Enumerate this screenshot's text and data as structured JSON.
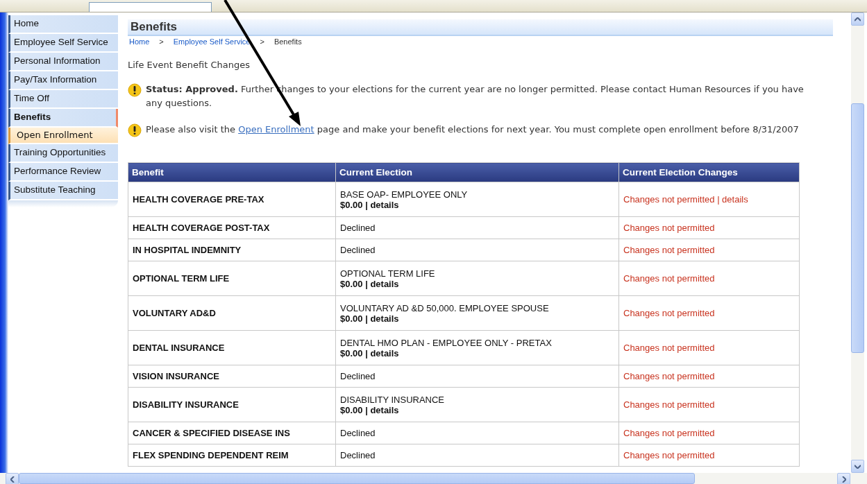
{
  "sidebar": {
    "items": [
      {
        "label": "Home",
        "selected": false
      },
      {
        "label": "Employee Self Service",
        "selected": false
      },
      {
        "label": "Personal Information",
        "selected": false
      },
      {
        "label": "Pay/Tax Information",
        "selected": false
      },
      {
        "label": "Time Off",
        "selected": false
      },
      {
        "label": "Benefits",
        "selected": true,
        "children": [
          {
            "label": "Open Enrollment",
            "highlighted": true
          }
        ]
      },
      {
        "label": "Training Opportunities",
        "selected": false
      },
      {
        "label": "Performance Review",
        "selected": false
      },
      {
        "label": "Substitute Teaching",
        "selected": false
      }
    ]
  },
  "page": {
    "title": "Benefits",
    "breadcrumb": [
      {
        "label": "Home",
        "kind": "link"
      },
      {
        "label": ">",
        "kind": "sep"
      },
      {
        "label": "Employee Self Service",
        "kind": "link"
      },
      {
        "label": ">",
        "kind": "sep"
      },
      {
        "label": "Benefits",
        "kind": "current"
      }
    ],
    "subtitle": "Life Event Benefit Changes",
    "alerts": [
      {
        "text": "**Status: Approved.** Further changes to your elections for the current year are no longer permitted.  Please contact Human Resources if you have any questions."
      },
      {
        "before": "Please also visit the ",
        "link": "Open Enrollment",
        "after": " page and make your benefit elections for next year. You must complete open enrollment before 8/31/2007"
      }
    ]
  },
  "table": {
    "columns": [
      "Benefit",
      "Current Election",
      "Current Election Changes"
    ],
    "rows": [
      {
        "benefit": "HEALTH COVERAGE PRE-TAX",
        "kind": "plan",
        "plan": "BASE OAP- EMPLOYEE ONLY",
        "cost": "$0.00 | details",
        "changes": "Changes not permitted | details"
      },
      {
        "benefit": "HEALTH COVERAGE POST-TAX",
        "kind": "declined",
        "plan": "Declined",
        "changes": "Changes not permitted"
      },
      {
        "benefit": "IN HOSPITAL INDEMNITY",
        "kind": "declined",
        "plan": "Declined",
        "changes": "Changes not permitted"
      },
      {
        "benefit": "OPTIONAL TERM LIFE",
        "kind": "plan",
        "plan": "OPTIONAL TERM LIFE",
        "cost": "$0.00 | details",
        "changes": "Changes not permitted"
      },
      {
        "benefit": "VOLUNTARY AD&D",
        "kind": "plan",
        "plan": "VOLUNTARY AD &D 50,000. EMPLOYEE SPOUSE",
        "cost": "$0.00 | details",
        "changes": "Changes not permitted"
      },
      {
        "benefit": "DENTAL INSURANCE",
        "kind": "plan",
        "plan": "DENTAL HMO PLAN - EMPLOYEE ONLY - PRETAX",
        "cost": "$0.00 | details",
        "changes": "Changes not permitted"
      },
      {
        "benefit": "VISION INSURANCE",
        "kind": "declined",
        "plan": "Declined",
        "changes": "Changes not permitted"
      },
      {
        "benefit": "DISABILITY INSURANCE",
        "kind": "plan",
        "plan": "DISABILITY INSURANCE",
        "cost": "$0.00 | details",
        "changes": "Changes not permitted"
      },
      {
        "benefit": "CANCER & SPECIFIED DISEASE INS",
        "kind": "declined",
        "plan": "Declined",
        "changes": "Changes not permitted"
      },
      {
        "benefit": "FLEX SPENDING DEPENDENT REIM",
        "kind": "declined",
        "plan": "Declined",
        "changes": "Changes not permitted"
      }
    ]
  }
}
